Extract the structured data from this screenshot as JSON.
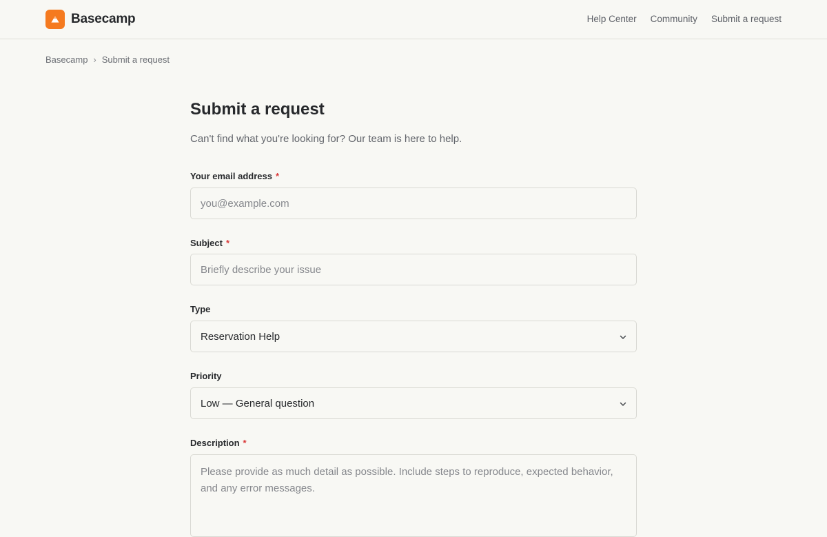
{
  "header": {
    "brand": "Basecamp",
    "brand_color": "#f57a1f",
    "brand_icon": "mountain-icon",
    "nav": [
      "Help Center",
      "Community",
      "Submit a request"
    ]
  },
  "breadcrumb": {
    "items": [
      "Basecamp",
      "Submit a request"
    ],
    "separator": "›"
  },
  "form": {
    "title": "Submit a request",
    "subtitle": "Can't find what you're looking for? Our team is here to help.",
    "email": {
      "label": "Your email address",
      "required_mark": "*",
      "placeholder": "you@example.com"
    },
    "subject": {
      "label": "Subject",
      "required_mark": "*",
      "placeholder": "Briefly describe your issue"
    },
    "type": {
      "label": "Type",
      "selected": "Reservation Help",
      "icon": "chevron-down-icon"
    },
    "priority": {
      "label": "Priority",
      "selected": "Low — General question",
      "icon": "chevron-down-icon"
    },
    "description": {
      "label": "Description",
      "required_mark": "*",
      "placeholder": "Please provide as much detail as possible. Include steps to reproduce, expected behavior, and any error messages."
    }
  },
  "colors": {
    "background": "#f8f8f4",
    "required": "#d93838",
    "border": "#d9d9d3"
  }
}
